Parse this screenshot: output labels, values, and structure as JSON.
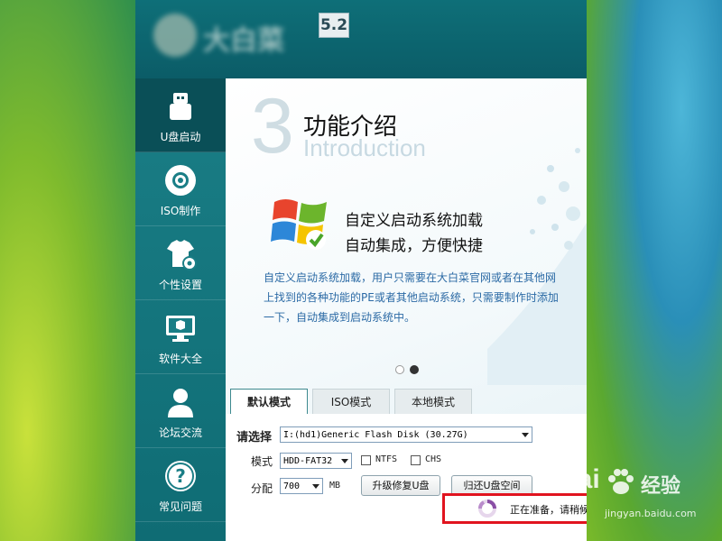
{
  "app": {
    "version": "5.2",
    "logo_text": "大白菜"
  },
  "sidebar": {
    "items": [
      {
        "label": "U盘启动",
        "icon": "usb-drive-icon",
        "active": true
      },
      {
        "label": "ISO制作",
        "icon": "disc-icon",
        "active": false
      },
      {
        "label": "个性设置",
        "icon": "shirt-gear-icon",
        "active": false
      },
      {
        "label": "软件大全",
        "icon": "monitor-box-icon",
        "active": false
      },
      {
        "label": "论坛交流",
        "icon": "user-icon",
        "active": false
      },
      {
        "label": "常见问题",
        "icon": "question-icon",
        "active": false
      }
    ]
  },
  "intro": {
    "number": "3",
    "title": "功能介绍",
    "subtitle": "Introduction",
    "heading_line1": "自定义启动系统加载",
    "heading_line2": "自动集成，方便快捷",
    "description": "自定义启动系统加载，用户只需要在大白菜官网或者在其他网上找到的各种功能的PE或者其他启动系统，只需要制作时添加一下，自动集成到启动系统中。"
  },
  "tabs": [
    {
      "label": "默认模式",
      "active": true
    },
    {
      "label": "ISO模式",
      "active": false
    },
    {
      "label": "本地模式",
      "active": false
    }
  ],
  "form": {
    "select_label": "请选择",
    "disk_value": "I:(hd1)Generic Flash Disk (30.27G)",
    "mode_label": "模式",
    "mode_value": "HDD-FAT32",
    "ntfs_label": "NTFS",
    "chs_label": "CHS",
    "alloc_label": "分配",
    "alloc_value": "700",
    "alloc_unit": "MB",
    "upgrade_button": "升级修复U盘",
    "restore_button": "归还U盘空间"
  },
  "status": {
    "text": "正在准备，请稍候 . . ."
  },
  "watermark": {
    "brand": "Bai",
    "brand_cn": "经验",
    "url": "jingyan.baidu.com"
  },
  "colors": {
    "title_bar": "#0e6f78",
    "sidebar": "#1a7e86",
    "sidebar_active": "#0a4f57",
    "status_border": "#e1141f",
    "desc_text": "#2b6aa5"
  }
}
